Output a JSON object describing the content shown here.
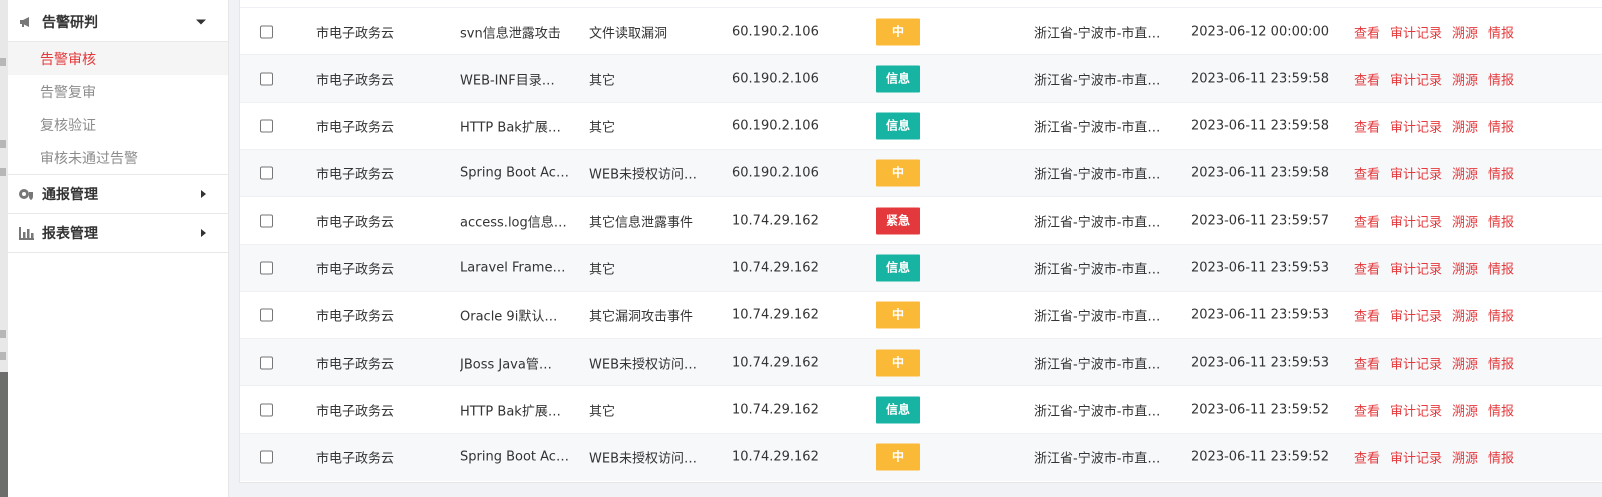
{
  "sidebar": {
    "groups": [
      {
        "label": "告警研判",
        "icon": "megaphone-icon",
        "expanded": true,
        "items": [
          {
            "label": "告警审核",
            "active": true
          },
          {
            "label": "告警复审",
            "active": false
          },
          {
            "label": "复核验证",
            "active": false
          },
          {
            "label": "审核未通过告警",
            "active": false
          }
        ]
      },
      {
        "label": "通报管理",
        "icon": "gear-shield-icon",
        "expanded": false,
        "items": []
      },
      {
        "label": "报表管理",
        "icon": "bar-chart-icon",
        "expanded": false,
        "items": []
      }
    ]
  },
  "colors": {
    "accent_red": "#e4393c",
    "badge_medium": "#fbb938",
    "badge_info": "#17b3a3",
    "badge_urgent": "#e4393c"
  },
  "actions": [
    "查看",
    "审计记录",
    "溯源",
    "情报"
  ],
  "rows": [
    {
      "unit": "市电子政务云",
      "name": "svn信息泄露攻击",
      "type": "文件读取漏洞",
      "ip": "60.190.2.106",
      "level": "中",
      "level_color": "#fbb938",
      "location": "浙江省-宁波市-市直…",
      "time": "2023-06-12 00:00:00"
    },
    {
      "unit": "市电子政务云",
      "name": "WEB-INF目录…",
      "type": "其它",
      "ip": "60.190.2.106",
      "level": "信息",
      "level_color": "#17b3a3",
      "location": "浙江省-宁波市-市直…",
      "time": "2023-06-11 23:59:58"
    },
    {
      "unit": "市电子政务云",
      "name": "HTTP Bak扩展…",
      "type": "其它",
      "ip": "60.190.2.106",
      "level": "信息",
      "level_color": "#17b3a3",
      "location": "浙江省-宁波市-市直…",
      "time": "2023-06-11 23:59:58"
    },
    {
      "unit": "市电子政务云",
      "name": "Spring Boot Ac…",
      "type": "WEB未授权访问…",
      "ip": "60.190.2.106",
      "level": "中",
      "level_color": "#fbb938",
      "location": "浙江省-宁波市-市直…",
      "time": "2023-06-11 23:59:58"
    },
    {
      "unit": "市电子政务云",
      "name": "access.log信息…",
      "type": "其它信息泄露事件",
      "ip": "10.74.29.162",
      "level": "紧急",
      "level_color": "#e4393c",
      "location": "浙江省-宁波市-市直…",
      "time": "2023-06-11 23:59:57"
    },
    {
      "unit": "市电子政务云",
      "name": "Laravel Frame…",
      "type": "其它",
      "ip": "10.74.29.162",
      "level": "信息",
      "level_color": "#17b3a3",
      "location": "浙江省-宁波市-市直…",
      "time": "2023-06-11 23:59:53"
    },
    {
      "unit": "市电子政务云",
      "name": "Oracle 9i默认…",
      "type": "其它漏洞攻击事件",
      "ip": "10.74.29.162",
      "level": "中",
      "level_color": "#fbb938",
      "location": "浙江省-宁波市-市直…",
      "time": "2023-06-11 23:59:53"
    },
    {
      "unit": "市电子政务云",
      "name": "JBoss Java管…",
      "type": "WEB未授权访问…",
      "ip": "10.74.29.162",
      "level": "中",
      "level_color": "#fbb938",
      "location": "浙江省-宁波市-市直…",
      "time": "2023-06-11 23:59:53"
    },
    {
      "unit": "市电子政务云",
      "name": "HTTP Bak扩展…",
      "type": "其它",
      "ip": "10.74.29.162",
      "level": "信息",
      "level_color": "#17b3a3",
      "location": "浙江省-宁波市-市直…",
      "time": "2023-06-11 23:59:52"
    },
    {
      "unit": "市电子政务云",
      "name": "Spring Boot Ac…",
      "type": "WEB未授权访问…",
      "ip": "10.74.29.162",
      "level": "中",
      "level_color": "#fbb938",
      "location": "浙江省-宁波市-市直…",
      "time": "2023-06-11 23:59:52"
    }
  ]
}
